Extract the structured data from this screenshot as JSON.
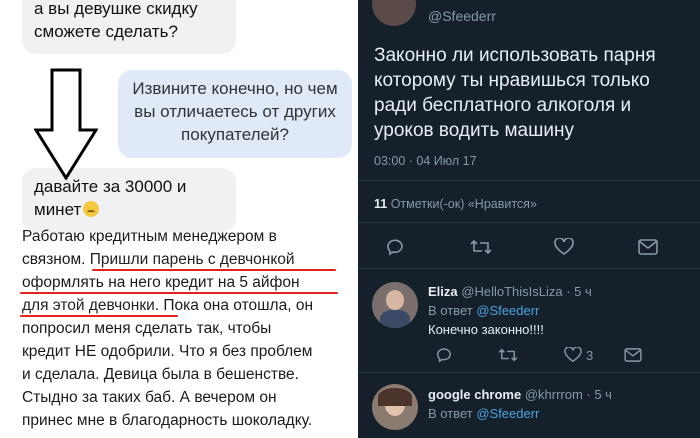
{
  "chat": {
    "msg1": "а вы девушке скидку сможете сделать?",
    "msg2": "Извините конечно, но чем вы отличаетесь от других покупателей?",
    "msg3": "давайте за 30000 и минет"
  },
  "story": {
    "line1": "Работаю кредитным менеджером в",
    "line2a": "связном. ",
    "line2b": "Пришли парень с девчонкой",
    "line3": "оформлять на него кредит на 5 айфон",
    "line4a": "для этой девчонки",
    "line4b": ". Пока она отошла, он",
    "line5": "попросил меня сделать так, чтобы",
    "line6": "кредит НЕ одобрили. Что я без проблем",
    "line7": "и сделала. Девица была в бешенстве.",
    "line8": "Стыдно за таких баб. А вечером он",
    "line9": "принес мне в благодарность шоколадку."
  },
  "tweet": {
    "handle": "@Sfeederr",
    "text": "Законно ли использовать парня которому ты нравишься только ради бесплатного алкоголя и уроков водить машину",
    "meta": "03:00 · 04 Июл 17",
    "likes_count": "11",
    "likes_label": "Отметки(-ок) «Нравится»"
  },
  "replies": [
    {
      "name": "Eliza",
      "handle": "@HelloThisIsLiza · 5 ч",
      "to_prefix": "В ответ ",
      "to_handle": "@Sfeederr",
      "text": "Конечно законно!!!!",
      "like_count": "3"
    },
    {
      "name": "google chrome",
      "handle": "@khrrrom · 5 ч",
      "to_prefix": "В ответ ",
      "to_handle": "@Sfeederr"
    }
  ],
  "colors": {
    "tw_bg": "#15202b",
    "link": "#4aa3e0",
    "underline": "#e0231d"
  }
}
